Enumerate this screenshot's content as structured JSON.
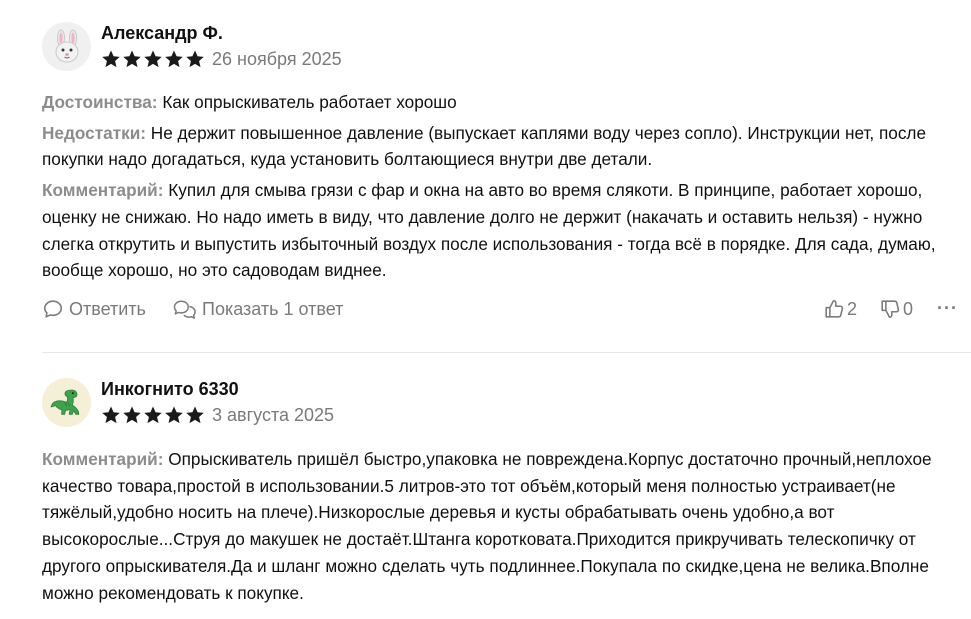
{
  "colors": {
    "text": "#111111",
    "muted": "#7a7a7a",
    "label": "#8c8c8c",
    "star": "#1a1a1a",
    "divider": "#e8e8e8"
  },
  "reviews": [
    {
      "author": "Александр Ф.",
      "avatar_icon": "rabbit-face-icon",
      "rating": 5,
      "date": "26 ноября 2025",
      "advantages_label": "Достоинства:",
      "advantages": "Как опрыскиватель работает хорошо",
      "disadvantages_label": "Недостатки:",
      "disadvantages": "Не держит повышенное давление (выпускает каплями воду через сопло). Инструкции нет, после покупки надо догадаться, куда установить болтающиеся внутри две детали.",
      "comment_label": "Комментарий:",
      "comment": "Купил для смыва грязи с фар и окна на авто во время слякоти. В принципе, работает хорошо, оценку не снижаю. Но надо иметь в виду, что давление долго не держит (накачать и оставить нельзя) - нужно слегка открутить и выпустить избыточный воздух после использования - тогда всё в порядке. Для сада, думаю, вообще хорошо, но это садоводам виднее.",
      "reply_label": "Ответить",
      "show_replies_label": "Показать 1 ответ",
      "likes": "2",
      "dislikes": "0",
      "more_label": "···"
    },
    {
      "author": "Инкогнито 6330",
      "avatar_icon": "dinosaur-icon",
      "rating": 5,
      "date": "3 августа 2025",
      "comment_label": "Комментарий:",
      "comment": "Опрыскиватель пришёл быстро,упаковка не повреждена.Корпус достаточно прочный,неплохое качество товара,простой в использовании.5 литров-это тот объём,который меня полностью устраивает(не тяжёлый,удобно носить на плече).Низкорослые деревья и кусты обрабатывать очень удобно,а вот высокорослые...Струя до макушек не достаёт.Штанга коротковата.Приходится прикручивать телескопичку от другого опрыскивателя.Да и шланг можно сделать чуть подлиннее.Покупала по скидке,цена не велика.Вполне можно рекомендовать к покупке."
    }
  ]
}
